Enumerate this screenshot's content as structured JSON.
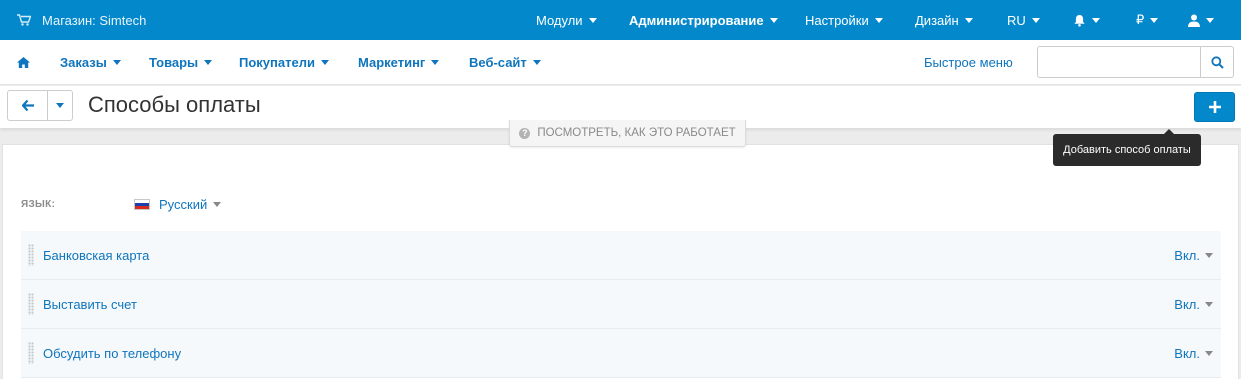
{
  "topbar": {
    "store": "Магазин: Simtech",
    "items": [
      "Модули",
      "Администрирование",
      "Настройки",
      "Дизайн",
      "RU"
    ],
    "currency": "₽"
  },
  "nav": {
    "items": [
      "Заказы",
      "Товары",
      "Покупатели",
      "Маркетинг",
      "Веб-сайт"
    ],
    "quick_menu": "Быстрое меню",
    "search_placeholder": ""
  },
  "header": {
    "title": "Способы оплаты",
    "how_it_works": "ПОСМОТРЕТЬ, КАК ЭТО РАБОТАЕТ",
    "add_tooltip": "Добавить способ оплаты"
  },
  "language": {
    "label": "ЯЗЫК:",
    "value": "Русский"
  },
  "payments": [
    {
      "name": "Банковская карта",
      "status": "Вкл."
    },
    {
      "name": "Выставить счет",
      "status": "Вкл."
    },
    {
      "name": "Обсудить по телефону",
      "status": "Вкл."
    }
  ],
  "colors": {
    "topbar": "#0388cc",
    "link": "#0f75bd",
    "row_bg": "#f5f9fc"
  }
}
